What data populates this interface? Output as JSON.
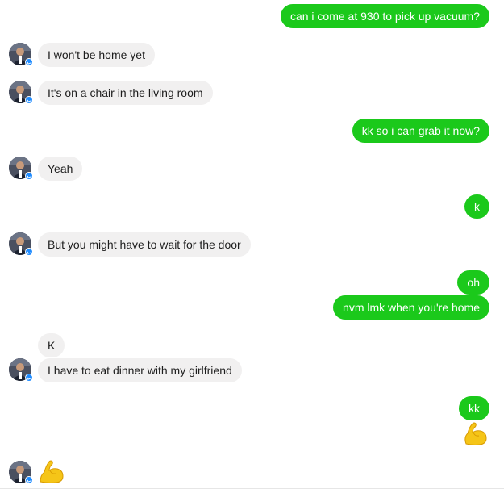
{
  "messages": [
    {
      "from": "me",
      "text": "can i come at 930 to pick up vacuum?"
    },
    {
      "from": "them",
      "text": "I won't be home yet"
    },
    {
      "from": "them",
      "text": "It's on a chair in the living room"
    },
    {
      "from": "me",
      "text": "kk so i can grab it now?"
    },
    {
      "from": "them",
      "text": "Yeah"
    },
    {
      "from": "me",
      "text": "k"
    },
    {
      "from": "them",
      "text": "But you might have to wait for the door"
    },
    {
      "from": "me",
      "text": "oh"
    },
    {
      "from": "me",
      "text": "nvm lmk when you're home"
    },
    {
      "from": "them",
      "text": "K"
    },
    {
      "from": "them",
      "text": "I have to eat dinner with my girlfriend"
    },
    {
      "from": "me",
      "text": "kk"
    },
    {
      "from": "me",
      "emoji": "flexed-biceps"
    },
    {
      "from": "them",
      "emoji": "flexed-biceps"
    }
  ],
  "colors": {
    "sent_bubble": "#1bc91b",
    "received_bubble": "#f1f0f0",
    "badge": "#1e8bff",
    "emoji": "#f5c518"
  }
}
